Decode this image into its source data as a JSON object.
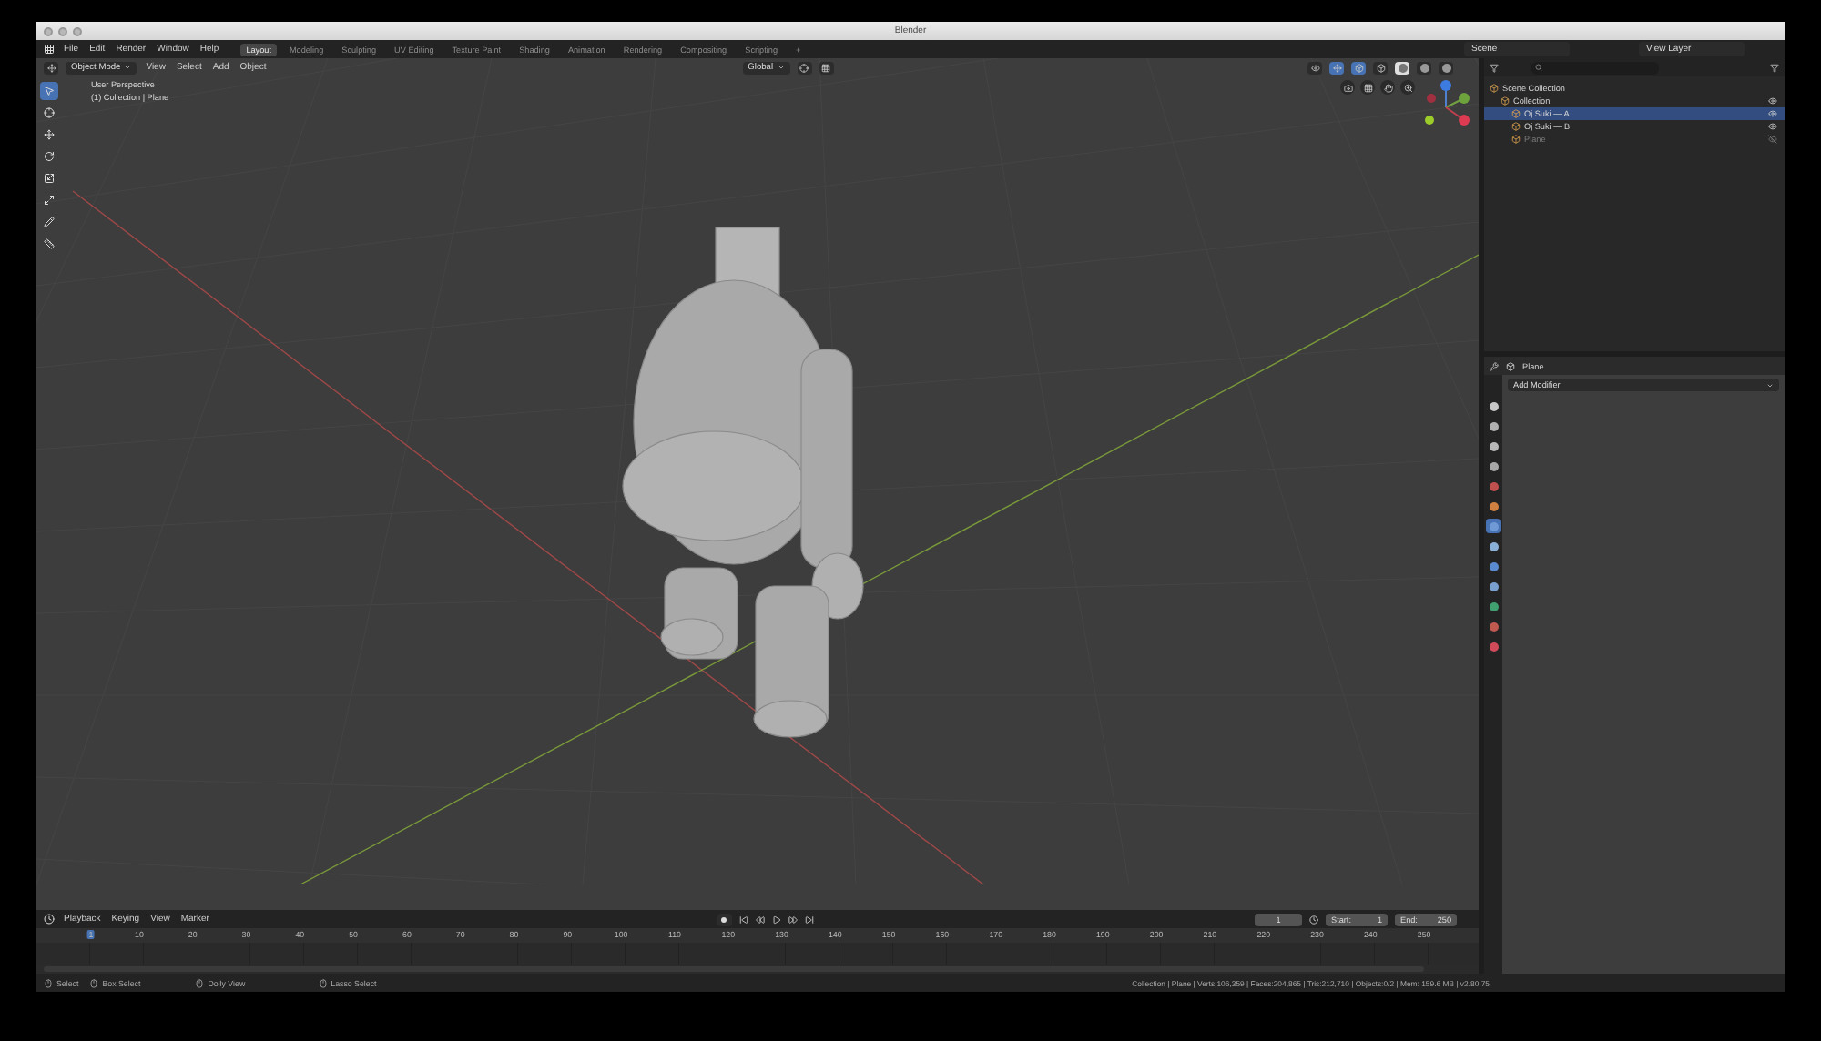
{
  "window": {
    "title": "Blender"
  },
  "menu": [
    "File",
    "Edit",
    "Render",
    "Window",
    "Help"
  ],
  "workspaces": [
    {
      "label": "Layout",
      "selected": true
    },
    {
      "label": "Modeling",
      "selected": false
    },
    {
      "label": "Sculpting",
      "selected": false
    },
    {
      "label": "UV Editing",
      "selected": false
    },
    {
      "label": "Texture Paint",
      "selected": false
    },
    {
      "label": "Shading",
      "selected": false
    },
    {
      "label": "Animation",
      "selected": false
    },
    {
      "label": "Rendering",
      "selected": false
    },
    {
      "label": "Compositing",
      "selected": false
    },
    {
      "label": "Scripting",
      "selected": false
    }
  ],
  "add_workspace": "+",
  "scene": {
    "name": "Scene",
    "view_layer": "View Layer"
  },
  "viewport": {
    "mode": "Object Mode",
    "menus": [
      "View",
      "Select",
      "Add",
      "Object"
    ],
    "orientation": "Global",
    "overlay_title": "User Perspective",
    "overlay_subtitle": "(1) Collection | Plane",
    "tools": [
      {
        "selected": true
      },
      {
        "selected": false
      },
      {
        "selected": false
      },
      {
        "selected": false
      },
      {
        "selected": false
      },
      {
        "selected": false
      },
      {
        "selected": false
      },
      {
        "selected": false
      }
    ]
  },
  "outliner": {
    "items": [
      {
        "label": "Scene Collection",
        "selected": false,
        "children": [
          {
            "label": "Collection",
            "selected": false,
            "visible": true,
            "children": [
              {
                "label": "Oj Suki — A",
                "selected": true,
                "visible": true
              },
              {
                "label": "Oj Suki — B",
                "selected": false,
                "visible": true
              },
              {
                "label": "Plane",
                "selected": false,
                "visible": false
              }
            ]
          }
        ]
      }
    ]
  },
  "properties": {
    "object": "Plane",
    "add_modifier": "Add Modifier",
    "tabs": [
      {
        "selected": false,
        "color": "#c8c8c8"
      },
      {
        "selected": false,
        "color": "#b0b0b0"
      },
      {
        "selected": false,
        "color": "#b8b8b8"
      },
      {
        "selected": false,
        "color": "#a8a8a8"
      },
      {
        "selected": false,
        "color": "#c05050"
      },
      {
        "selected": false,
        "color": "#d08040"
      },
      {
        "selected": true,
        "color": "#6f9ad6"
      },
      {
        "selected": false,
        "color": "#8ab0d8"
      },
      {
        "selected": false,
        "color": "#5a8ad0"
      },
      {
        "selected": false,
        "color": "#7aa0d0"
      },
      {
        "selected": false,
        "color": "#40a070"
      },
      {
        "selected": false,
        "color": "#c05a50"
      },
      {
        "selected": false,
        "color": "#d04a5a"
      }
    ]
  },
  "timeline": {
    "menus": [
      "Playback",
      "Keying",
      "View",
      "Marker"
    ],
    "current_frame": "1",
    "start_label": "Start:",
    "start": "1",
    "end_label": "End:",
    "end": "250",
    "ticks": [
      "1",
      "10",
      "20",
      "30",
      "40",
      "50",
      "60",
      "70",
      "80",
      "90",
      "100",
      "110",
      "120",
      "130",
      "140",
      "150",
      "160",
      "170",
      "180",
      "190",
      "200",
      "210",
      "220",
      "230",
      "240",
      "250"
    ]
  },
  "status": {
    "left": [
      "Select",
      "Box Select",
      "Dolly View",
      "Lasso Select"
    ],
    "right": "Collection | Plane | Verts:106,359 | Faces:204,865 | Tris:212,710 | Objects:0/2 | Mem: 159.6 MB | v2.80.75"
  }
}
